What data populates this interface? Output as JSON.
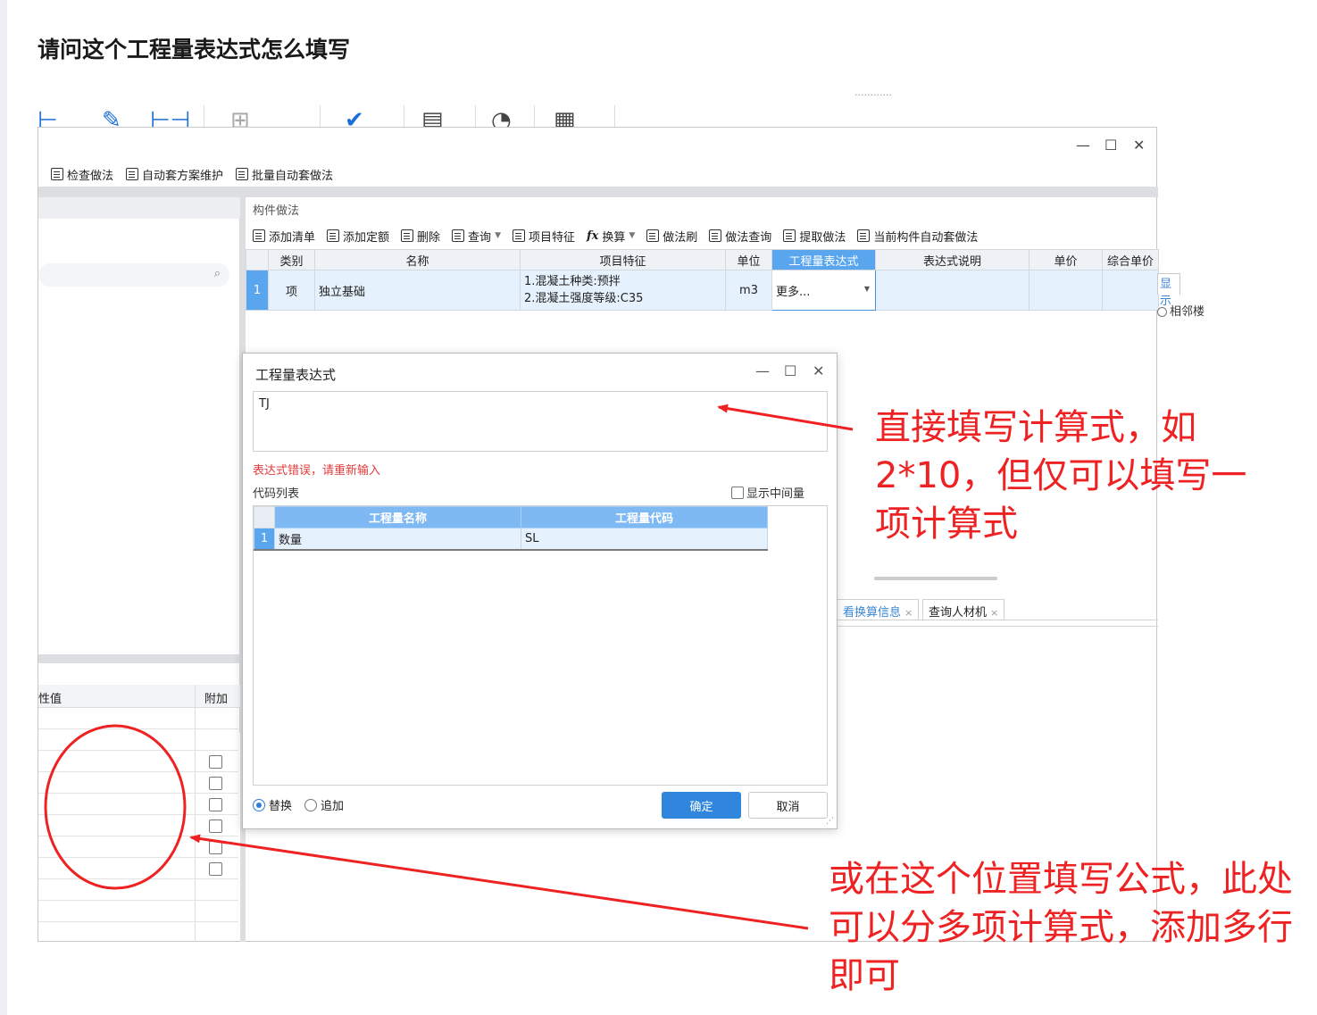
{
  "page": {
    "title": "请问这个工程量表达式怎么填写"
  },
  "software": {
    "toolbar": {
      "items": [
        "检查做法",
        "自动套方案维护",
        "批量自动套做法"
      ]
    },
    "panel": {
      "title": "构件做法",
      "toolbar": [
        "添加清单",
        "添加定额",
        "删除",
        "查询",
        "项目特征",
        "换算",
        "做法刷",
        "做法查询",
        "提取做法",
        "当前构件自动套做法"
      ],
      "fx_glyph": "fx",
      "columns": [
        "类别",
        "名称",
        "项目特征",
        "单位",
        "工程量表达式",
        "表达式说明",
        "单价",
        "综合单价"
      ],
      "row": {
        "num": "1",
        "type": "项",
        "name": "独立基础",
        "feature_line1": "1.混凝土种类:预拌",
        "feature_line2": "2.混凝土强度等级:C35",
        "unit": "m3",
        "expr": "更多..."
      }
    },
    "right_peek": {
      "tab": "显示",
      "radio": "相邻楼"
    },
    "bottom_tabs": [
      "看换算信息",
      "查询人材机"
    ],
    "left_attr": {
      "col_value": "性值",
      "col_extra": "附加"
    },
    "dialog": {
      "title": "工程量表达式",
      "input_value": "TJ",
      "error": "表达式错误，请重新输入",
      "code_list_label": "代码列表",
      "show_middle_label": "显示中间量",
      "columns": [
        "工程量名称",
        "工程量代码"
      ],
      "rows": [
        {
          "num": "1",
          "name": "数量",
          "code": "SL"
        }
      ],
      "radio_replace": "替换",
      "radio_append": "追加",
      "ok": "确定",
      "cancel": "取消"
    }
  },
  "annotations": {
    "note1": "直接填写计算式，如2*10，但仅可以填写一项计算式",
    "note2": "或在这个位置填写公式，此处可以分多项计算式，添加多行即可",
    "color": "#ee2222"
  }
}
